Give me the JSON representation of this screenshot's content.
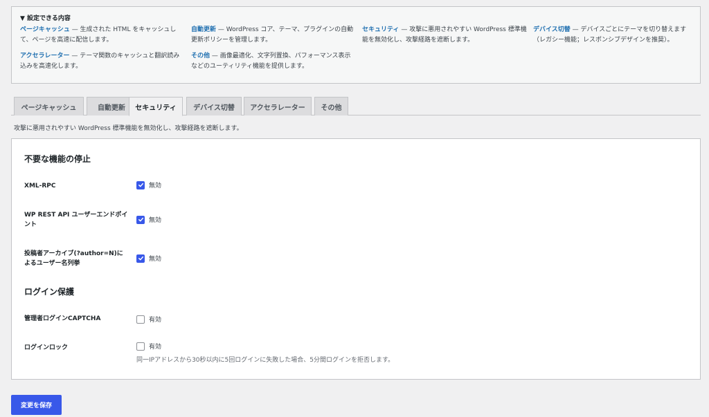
{
  "summary": {
    "title": "▼ 設定できる内容",
    "items": [
      {
        "name": "ページキャッシュ",
        "text": " — 生成された HTML をキャッシュして、ページを高速に配信します。"
      },
      {
        "name": "自動更新",
        "text": " — WordPress コア、テーマ、プラグインの自動更新ポリシーを管理します。"
      },
      {
        "name": "セキュリティ",
        "text": " — 攻撃に悪用されやすい WordPress 標準機能を無効化し、攻撃経路を遮断します。"
      },
      {
        "name": "デバイス切替",
        "text": " — デバイスごとにテーマを切り替えます（レガシー機能；レスポンシブデザインを推奨）。"
      },
      {
        "name": "アクセラレーター",
        "text": " — テーマ関数のキャッシュと翻訳読み込みを高速化します。"
      },
      {
        "name": "その他",
        "text": " — 画像最適化、文字列置換、パフォーマンス表示などのユーティリティ機能を提供します。"
      }
    ]
  },
  "tabs": [
    {
      "label": "ページキャッシュ",
      "active": false
    },
    {
      "label": "自動更新",
      "active": false
    },
    {
      "label": "セキュリティ",
      "active": true
    },
    {
      "label": "デバイス切替",
      "active": false
    },
    {
      "label": "アクセラレーター",
      "active": false
    },
    {
      "label": "その他",
      "active": false
    }
  ],
  "tab_description": "攻撃に悪用されやすい WordPress 標準機能を無効化し、攻撃経路を遮断します。",
  "panel": {
    "section1_title": "不要な機能の停止",
    "xmlrpc": {
      "label": "XML-RPC",
      "option": "無効",
      "checked": true
    },
    "rest_api": {
      "label": "WP REST API ユーザーエンドポイント",
      "option": "無効",
      "checked": true
    },
    "author_archive": {
      "label": "投稿者アーカイブ(?author=N)によるユーザー名列挙",
      "option": "無効",
      "checked": true
    },
    "section2_title": "ログイン保護",
    "captcha": {
      "label": "管理者ログインCAPTCHA",
      "option": "有効",
      "checked": false
    },
    "login_lock": {
      "label": "ログインロック",
      "option": "有効",
      "checked": false,
      "help": "同一IPアドレスから30秒以内に5回ログインに失敗した場合、5分間ログインを拒否します。"
    }
  },
  "save_label": "変更を保存",
  "colors": {
    "accent": "#3858e9",
    "link": "#2271b1"
  }
}
